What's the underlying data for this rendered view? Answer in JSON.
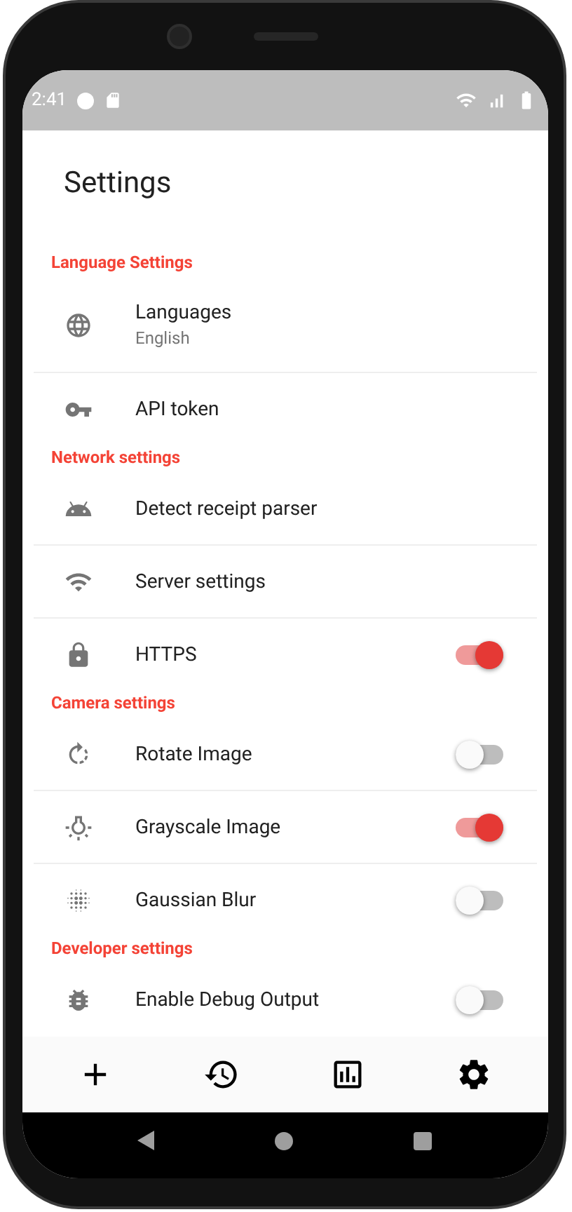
{
  "status_bar": {
    "time": "2:41"
  },
  "title": "Settings",
  "sections": [
    {
      "header": "Language Settings",
      "items": [
        {
          "kind": "link",
          "title": "Languages",
          "subtitle": "English"
        },
        {
          "kind": "link",
          "title": "API token"
        }
      ]
    },
    {
      "header": "Network settings",
      "items": [
        {
          "kind": "link",
          "title": "Detect receipt parser"
        },
        {
          "kind": "link",
          "title": "Server settings"
        },
        {
          "kind": "toggle",
          "title": "HTTPS",
          "on": true
        }
      ]
    },
    {
      "header": "Camera settings",
      "items": [
        {
          "kind": "toggle",
          "title": "Rotate Image",
          "on": false
        },
        {
          "kind": "toggle",
          "title": "Grayscale Image",
          "on": true
        },
        {
          "kind": "toggle",
          "title": "Gaussian Blur",
          "on": false
        }
      ]
    },
    {
      "header": "Developer settings",
      "items": [
        {
          "kind": "toggle",
          "title": "Enable Debug Output",
          "on": false
        }
      ]
    }
  ]
}
